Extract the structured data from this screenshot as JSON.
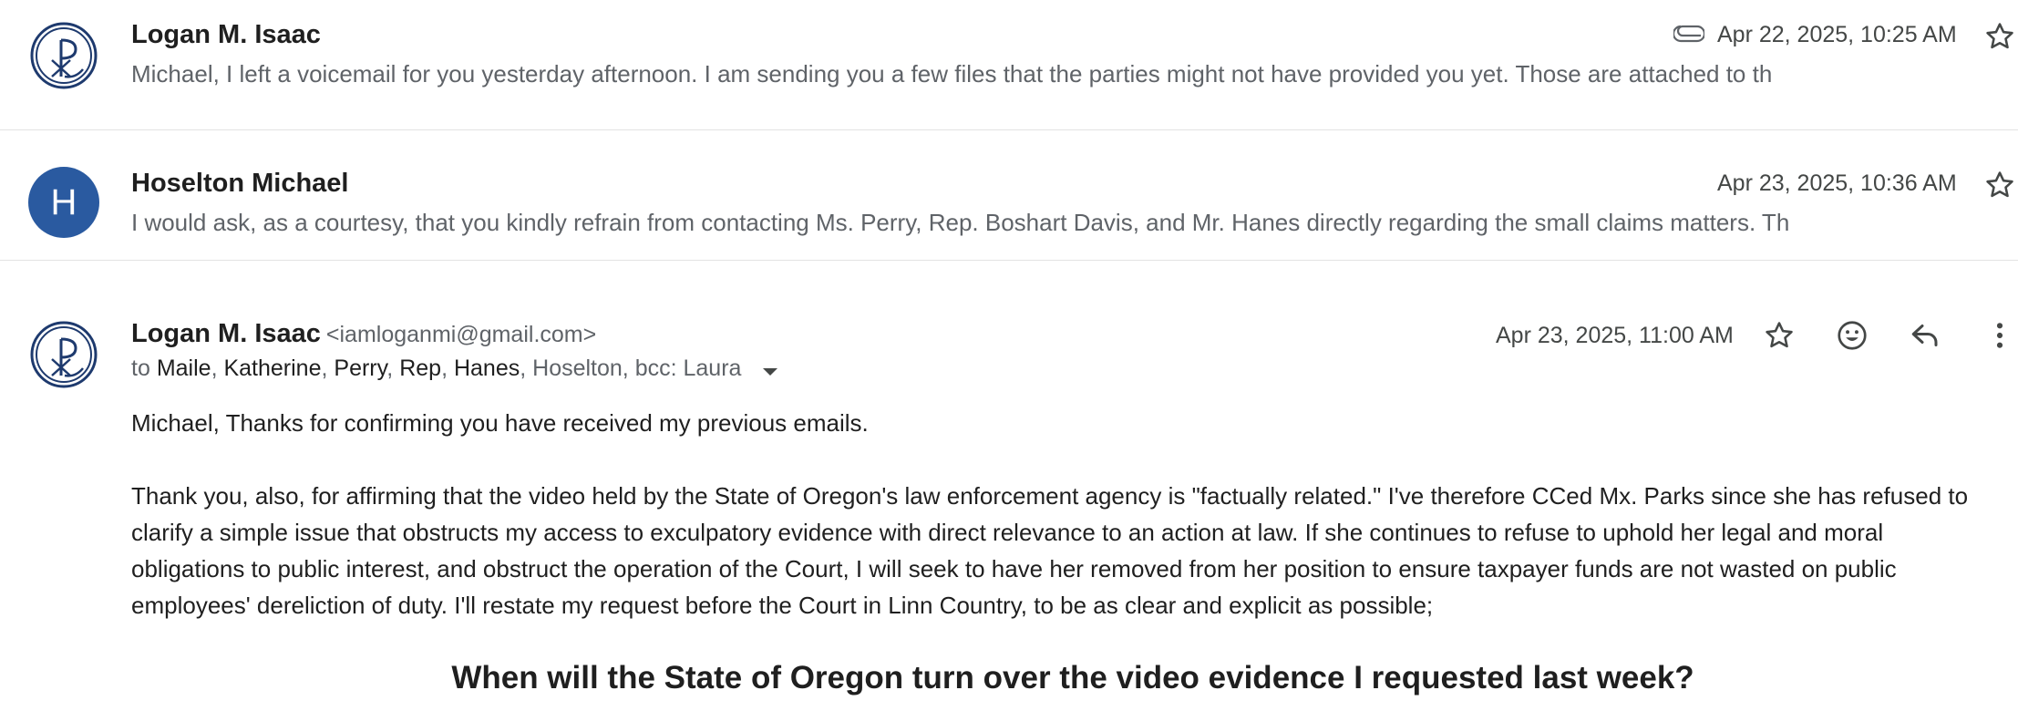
{
  "messages": [
    {
      "sender": "Logan M. Isaac",
      "snippet": "Michael, I left a voicemail for you yesterday afternoon. I am sending you a few files that the parties might not have provided you yet. Those are attached to th",
      "date": "Apr 22, 2025, 10:25 AM",
      "has_attachment": true
    },
    {
      "sender": "Hoselton Michael",
      "avatar_letter": "H",
      "snippet": "I would ask, as a courtesy, that you kindly refrain from contacting Ms. Perry, Rep. Boshart Davis, and Mr. Hanes directly regarding the small claims matters. Th",
      "date": "Apr 23, 2025, 10:36 AM"
    }
  ],
  "open_message": {
    "sender": "Logan M. Isaac",
    "email": "<iamloganmi@gmail.com>",
    "date": "Apr 23, 2025, 11:00 AM",
    "to_prefix": "to",
    "recipients": [
      "Maile",
      "Katherine",
      "Perry",
      "Rep",
      "Hanes"
    ],
    "recipients_grey": "Hoselton, bcc: Laura",
    "body": [
      "Michael, Thanks for confirming you have received my previous emails.",
      "Thank you, also, for affirming that the video held by the State of Oregon's law enforcement agency is \"factually related.\" I've therefore CCed Mx. Parks since she has refused to clarify a simple issue that obstructs my access to exculpatory evidence with direct relevance to an action at law. If she continues to refuse to uphold her legal and moral obligations to public interest, and obstruct the operation of the Court, I will seek to have her removed from her position to ensure taxpayer funds are not wasted on public employees' dereliction of duty. I'll restate my request before the Court in Linn Country, to be as clear and explicit as possible;"
    ],
    "headline": "When will the State of Oregon turn over the video evidence I requested last week?"
  },
  "icons": {
    "avatar_logo": "chi-rho-logo",
    "attachment": "paperclip-icon",
    "star": "star-icon",
    "emoji": "emoji-icon",
    "reply": "reply-icon",
    "more": "more-vert-icon",
    "caret": "caret-down-icon"
  },
  "colors": {
    "avatar_blue": "#2a5aa0",
    "logo_navy": "#1e3a6e",
    "secondary_text": "#5f6368"
  }
}
